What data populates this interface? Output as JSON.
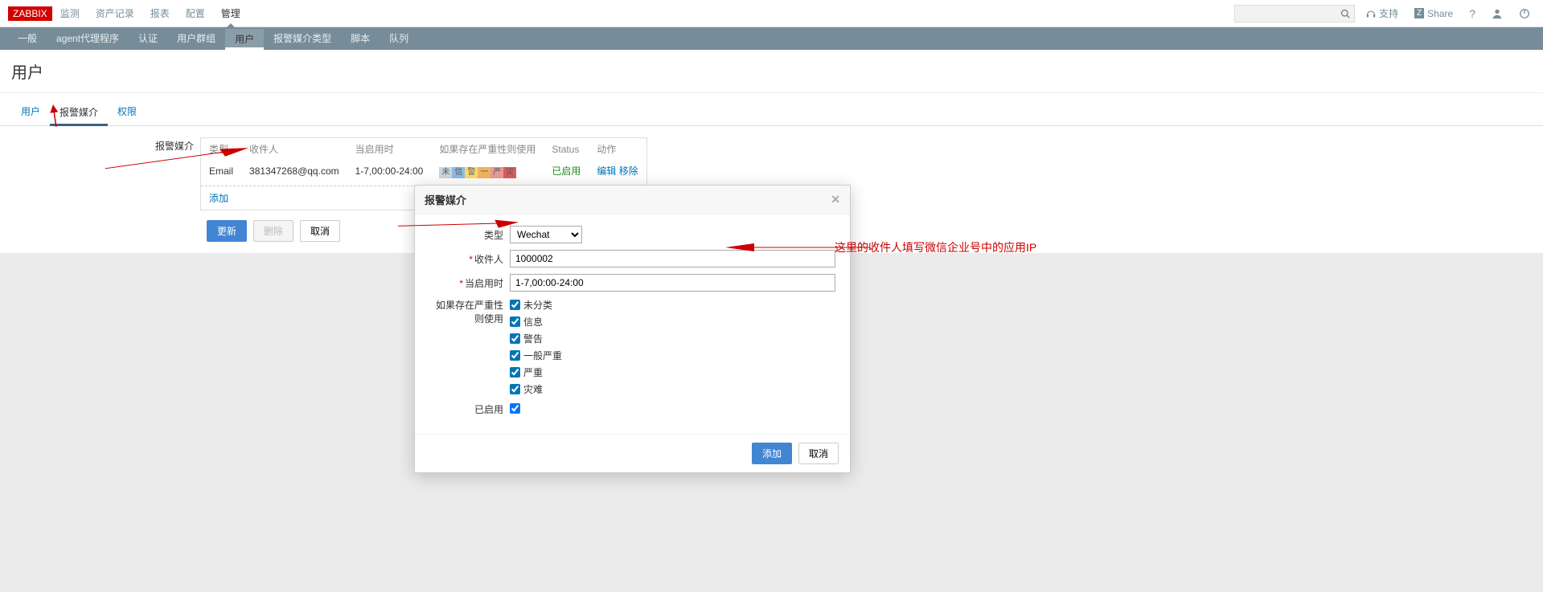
{
  "brand": "ZABBIX",
  "top_nav": [
    "监测",
    "资产记录",
    "报表",
    "配置",
    "管理"
  ],
  "top_nav_active": 4,
  "top_right": {
    "support": "支持",
    "share": "Share"
  },
  "sub_nav": [
    "一般",
    "agent代理程序",
    "认证",
    "用户群组",
    "用户",
    "报警媒介类型",
    "脚本",
    "队列"
  ],
  "sub_nav_active": 4,
  "page_title": "用户",
  "tabs": [
    "用户",
    "报警媒介",
    "权限"
  ],
  "tabs_active": 1,
  "media_section": {
    "label": "报警媒介",
    "headers": {
      "type": "类型",
      "recipient": "收件人",
      "when": "当启用时",
      "severity": "如果存在严重性则使用",
      "status": "Status",
      "action": "动作"
    },
    "row": {
      "type": "Email",
      "recipient": "381347268@qq.com",
      "when": "1-7,00:00-24:00",
      "status": "已启用",
      "edit": "编辑",
      "remove": "移除"
    },
    "sev_chars": [
      "未",
      "信",
      "警",
      "一",
      "严",
      "灾"
    ],
    "add": "添加"
  },
  "buttons": {
    "update": "更新",
    "delete": "删除",
    "cancel": "取消"
  },
  "modal": {
    "title": "报警媒介",
    "labels": {
      "type": "类型",
      "recipient": "收件人",
      "when": "当启用时",
      "severity": "如果存在严重性则使用",
      "enabled": "已启用"
    },
    "type_value": "Wechat",
    "recipient_value": "1000002",
    "when_value": "1-7,00:00-24:00",
    "severities": [
      "未分类",
      "信息",
      "警告",
      "一般严重",
      "严重",
      "灾难"
    ],
    "footer": {
      "add": "添加",
      "cancel": "取消"
    }
  },
  "annotation": "这里的收件人填写微信企业号中的应用IP"
}
